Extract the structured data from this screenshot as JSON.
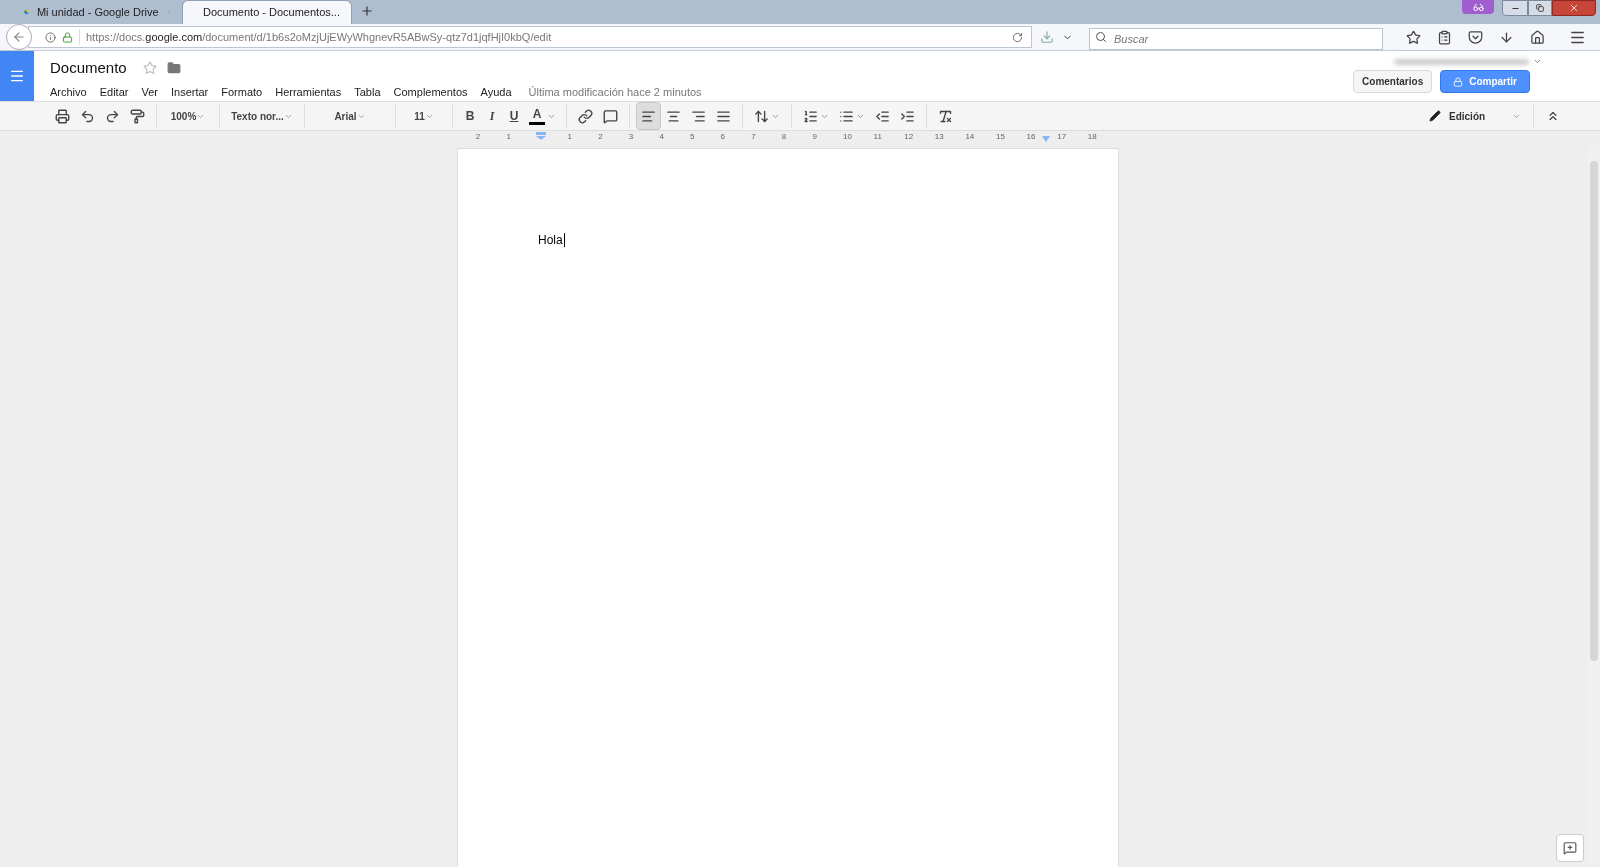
{
  "browser": {
    "tabs": [
      {
        "title": "Mi unidad - Google Drive",
        "selected": false
      },
      {
        "title": "Documento - Documentos...",
        "selected": true
      }
    ],
    "url": {
      "prefix": "https://docs.",
      "domain": "google.com",
      "path": "/document/d/1b6s2oMzjUjEWyWhgnevR5ABwSy-qtz7d1jqfHjI0kbQ/edit"
    },
    "search": {
      "placeholder": "Buscar"
    }
  },
  "doc": {
    "title": "Documento",
    "menu": [
      "Archivo",
      "Editar",
      "Ver",
      "Insertar",
      "Formato",
      "Herramientas",
      "Tabla",
      "Complementos",
      "Ayuda"
    ],
    "last_edit": "Última modificación hace 2 minutos",
    "comments_button": "Comentarios",
    "share_button": "Compartir"
  },
  "toolbar": [
    [
      {
        "kind": "icon",
        "selected": false
      },
      {
        "kind": "icon",
        "selected": false
      },
      {
        "kind": "icon",
        "selected": false
      },
      {
        "kind": "icon",
        "selected": false
      }
    ],
    [
      {
        "kind": "dropdown",
        "label": "100%"
      }
    ],
    [
      {
        "kind": "dropdown",
        "label": "Texto nor..."
      }
    ],
    [
      {
        "kind": "dropdown",
        "label": "Arial"
      }
    ],
    [
      {
        "kind": "dropdown",
        "label": "11"
      }
    ],
    [
      {
        "kind": "text",
        "label": "B"
      },
      {
        "kind": "text",
        "label": "I"
      },
      {
        "kind": "text",
        "label": "U"
      },
      {
        "kind": "color",
        "label": "A"
      }
    ],
    [
      {
        "kind": "icon",
        "selected": false
      },
      {
        "kind": "icon",
        "selected": false
      }
    ],
    [
      {
        "kind": "icon",
        "selected": true
      },
      {
        "kind": "icon",
        "selected": false
      },
      {
        "kind": "icon",
        "selected": false
      },
      {
        "kind": "icon",
        "selected": false
      }
    ],
    [
      {
        "kind": "icon",
        "selected": false
      }
    ],
    [
      {
        "kind": "icon",
        "selected": false
      },
      {
        "kind": "icon",
        "selected": false
      },
      {
        "kind": "icon",
        "selected": false
      },
      {
        "kind": "icon",
        "selected": false
      }
    ],
    [
      {
        "kind": "icon",
        "selected": false
      }
    ]
  ],
  "mode": {
    "label": "Edición"
  },
  "ruler": [
    "2",
    "1",
    "1",
    "2",
    "3",
    "4",
    "5",
    "6",
    "7",
    "8",
    "9",
    "10",
    "11",
    "12",
    "13",
    "14",
    "15",
    "16",
    "17",
    "18"
  ],
  "body": "Hola"
}
